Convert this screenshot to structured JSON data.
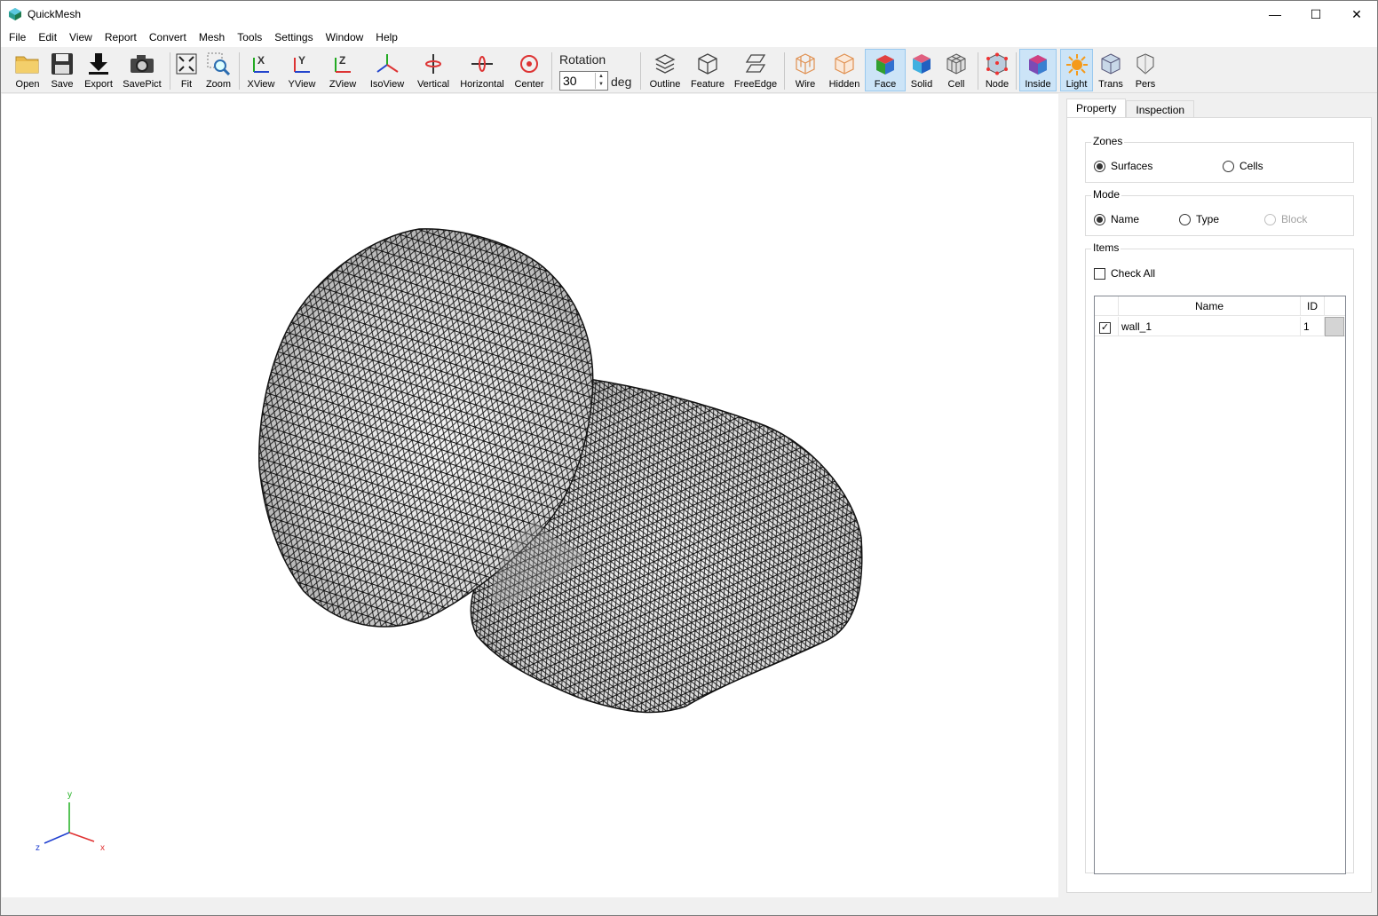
{
  "window": {
    "title": "QuickMesh",
    "controls": {
      "minimize": "—",
      "maximize": "☐",
      "close": "✕"
    }
  },
  "menu": [
    "File",
    "Edit",
    "View",
    "Report",
    "Convert",
    "Mesh",
    "Tools",
    "Settings",
    "Window",
    "Help"
  ],
  "toolbar": {
    "buttons": [
      {
        "label": "Open",
        "icon": "folder-icon"
      },
      {
        "label": "Save",
        "icon": "floppy-icon"
      },
      {
        "label": "Export",
        "icon": "download-icon"
      },
      {
        "label": "SavePict",
        "icon": "camera-icon"
      },
      {
        "label": "Fit",
        "icon": "fit-icon"
      },
      {
        "label": "Zoom",
        "icon": "zoom-icon"
      },
      {
        "label": "XView",
        "icon": "xview-icon"
      },
      {
        "label": "YView",
        "icon": "yview-icon"
      },
      {
        "label": "ZView",
        "icon": "zview-icon"
      },
      {
        "label": "IsoView",
        "icon": "isoview-icon"
      },
      {
        "label": "Vertical",
        "icon": "vertical-rotate-icon"
      },
      {
        "label": "Horizontal",
        "icon": "horizontal-rotate-icon"
      },
      {
        "label": "Center",
        "icon": "center-icon"
      },
      {
        "label": "Outline",
        "icon": "outline-icon"
      },
      {
        "label": "Feature",
        "icon": "feature-icon"
      },
      {
        "label": "FreeEdge",
        "icon": "free-edge-icon"
      },
      {
        "label": "Wire",
        "icon": "wire-icon"
      },
      {
        "label": "Hidden",
        "icon": "hidden-icon"
      },
      {
        "label": "Face",
        "icon": "face-icon",
        "active": true
      },
      {
        "label": "Solid",
        "icon": "solid-icon"
      },
      {
        "label": "Cell",
        "icon": "cell-icon"
      },
      {
        "label": "Node",
        "icon": "node-icon"
      },
      {
        "label": "Inside",
        "icon": "inside-icon",
        "active": true
      },
      {
        "label": "Light",
        "icon": "light-icon",
        "active": true
      },
      {
        "label": "Trans",
        "icon": "trans-icon"
      },
      {
        "label": "Pers",
        "icon": "pers-icon"
      }
    ],
    "rotation_label": "Rotation",
    "rotation_value": "30",
    "rotation_unit": "deg"
  },
  "panel": {
    "tabs": [
      "Property",
      "Inspection"
    ],
    "active_tab": "Property",
    "zones": {
      "title": "Zones",
      "options": [
        "Surfaces",
        "Cells"
      ],
      "selected": "Surfaces"
    },
    "mode": {
      "title": "Mode",
      "options": [
        "Name",
        "Type",
        "Block"
      ],
      "selected": "Name",
      "disabled": [
        "Block"
      ]
    },
    "items": {
      "title": "Items",
      "check_all_label": "Check All",
      "columns": [
        "Name",
        "ID"
      ],
      "rows": [
        {
          "checked": true,
          "name": "wall_1",
          "id": "1",
          "color": "#d4d4d4"
        }
      ]
    }
  },
  "axes": {
    "y": "y",
    "x": "x",
    "z": "z"
  },
  "colors": {
    "accent_active": "#cce4f7",
    "axis_x": "#e03030",
    "axis_y": "#20b020",
    "axis_z": "#2040d0"
  }
}
